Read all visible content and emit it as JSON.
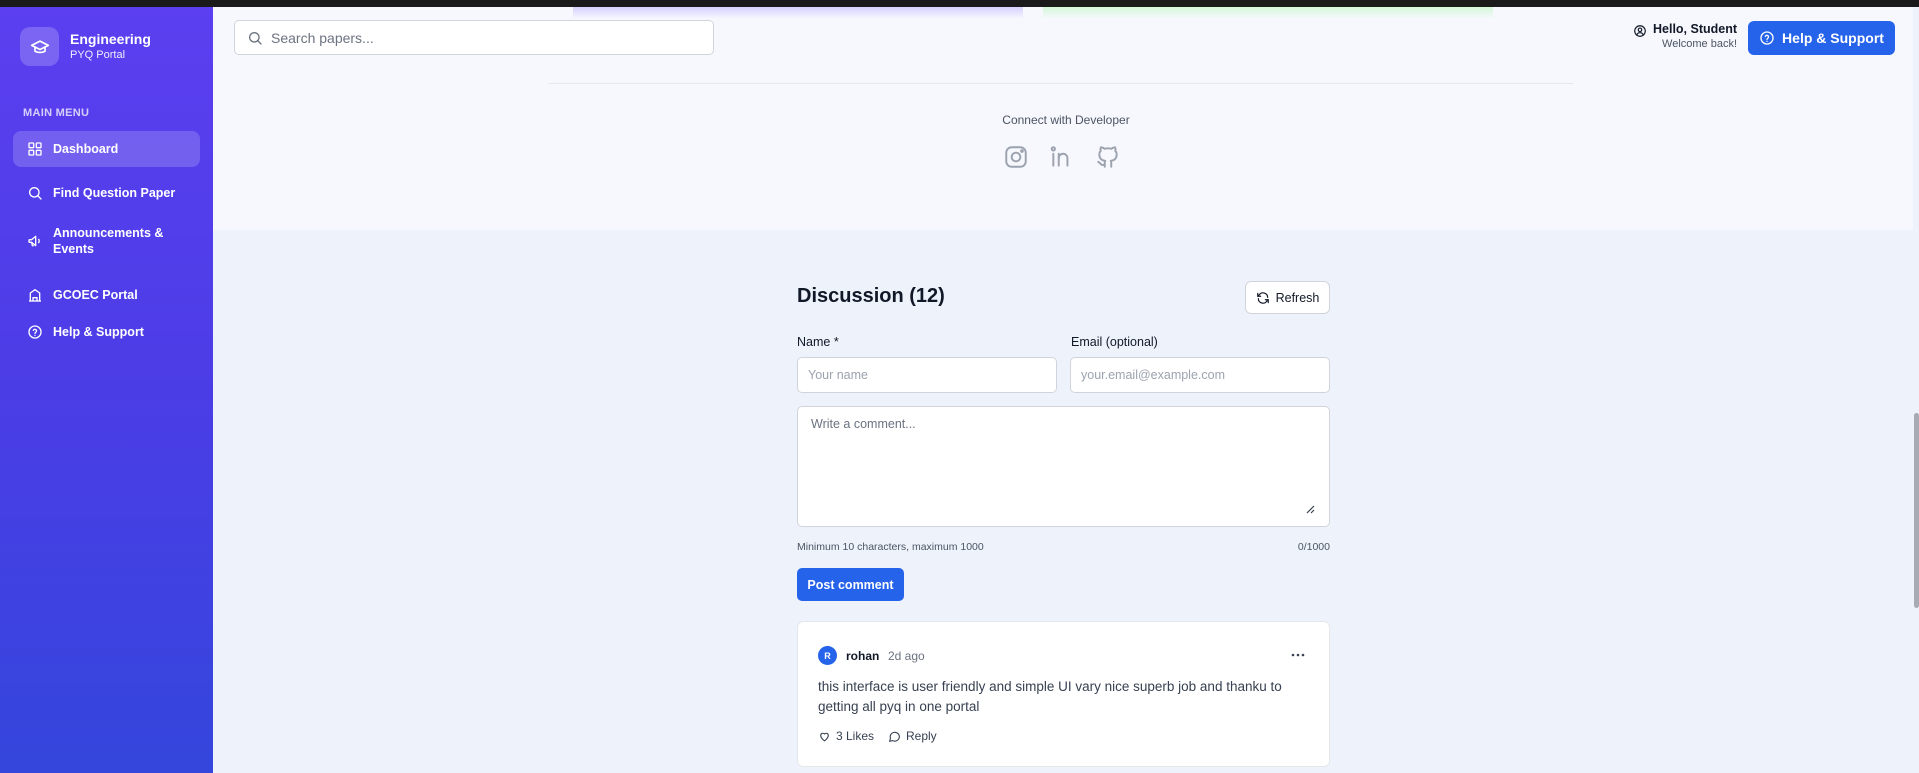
{
  "brand": {
    "title": "Engineering",
    "subtitle": "PYQ Portal",
    "icon": "graduation-cap-icon"
  },
  "sidebar": {
    "heading": "MAIN MENU",
    "items": [
      {
        "label": "Dashboard",
        "icon": "grid-icon",
        "active": true
      },
      {
        "label": "Find Question Paper",
        "icon": "search-icon",
        "active": false
      },
      {
        "label": "Announcements & Events",
        "icon": "megaphone-icon",
        "active": false
      },
      {
        "label": "GCOEC Portal",
        "icon": "building-icon",
        "active": false
      },
      {
        "label": "Help & Support",
        "icon": "help-circle-icon",
        "active": false
      }
    ]
  },
  "header": {
    "search_placeholder": "Search papers...",
    "greeting": "Hello, Student",
    "welcome": "Welcome back!",
    "help_label": "Help & Support"
  },
  "footer": {
    "connect_label": "Connect with Developer",
    "socials": [
      "instagram-icon",
      "linkedin-icon",
      "github-icon"
    ]
  },
  "discussion": {
    "title": "Discussion (12)",
    "refresh_label": "Refresh",
    "name_label": "Name *",
    "name_placeholder": "Your name",
    "email_label": "Email (optional)",
    "email_placeholder": "your.email@example.com",
    "comment_placeholder": "Write a comment...",
    "hint": "Minimum 10 characters, maximum 1000",
    "counter": "0/1000",
    "post_label": "Post comment",
    "comments": [
      {
        "avatar": "R",
        "author": "rohan",
        "time": "2d ago",
        "body": "this interface is user friendly and simple UI vary nice superb job and thanku to getting all pyq in one portal",
        "likes": "3 Likes",
        "reply": "Reply"
      }
    ]
  },
  "colors": {
    "sidebar_top": "#5b3ff0",
    "sidebar_bottom": "#3446dc",
    "accent": "#2563eb",
    "background": "#eef2fb"
  }
}
